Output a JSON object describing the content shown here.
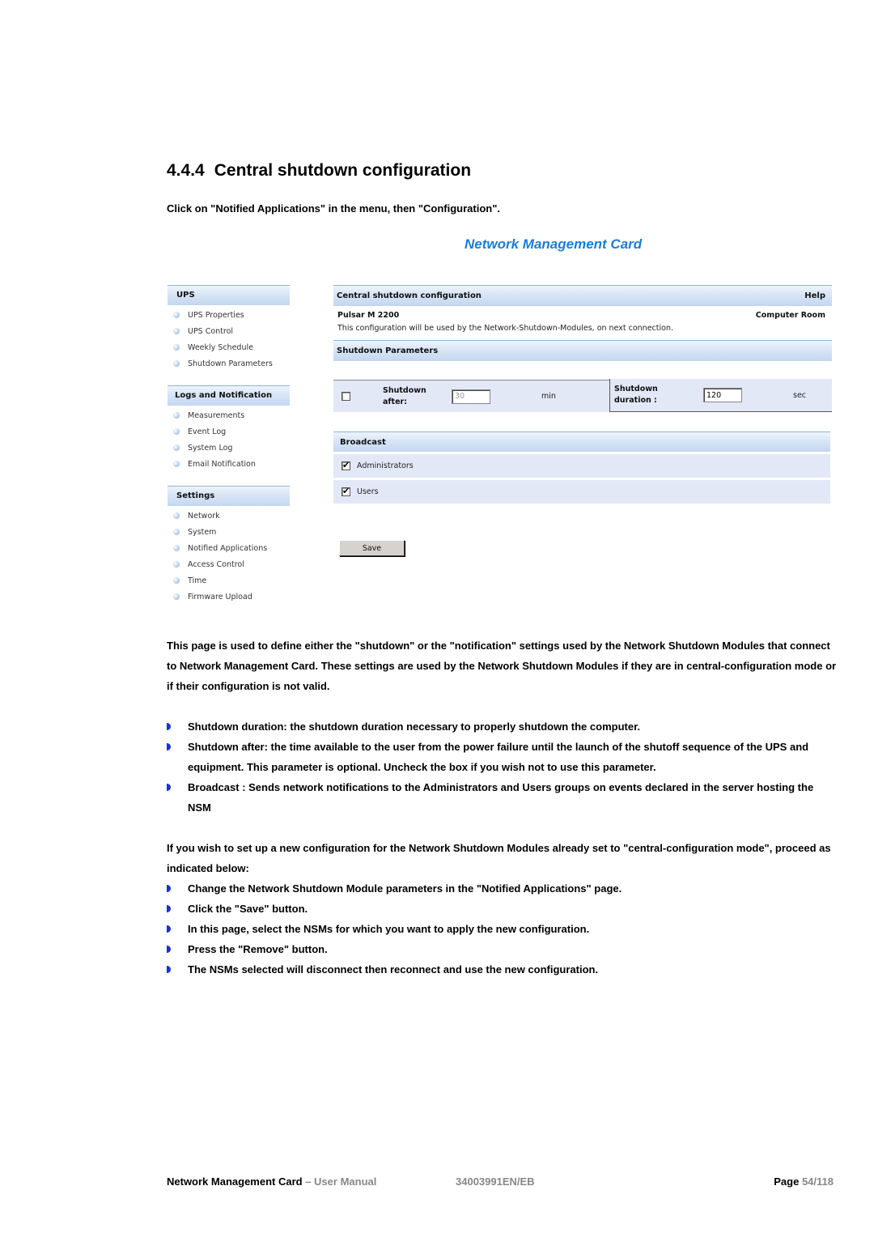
{
  "document": {
    "section_number": "4.4.4",
    "section_title": "Central shutdown configuration",
    "intro": "Click on \"Notified Applications\" in the menu, then \"Configuration\"."
  },
  "screenshot": {
    "app_title": "Network Management Card",
    "sidebar": {
      "groups": [
        {
          "title": "UPS",
          "items": [
            "UPS Properties",
            "UPS Control",
            "Weekly Schedule",
            "Shutdown Parameters"
          ]
        },
        {
          "title": "Logs and Notification",
          "items": [
            "Measurements",
            "Event Log",
            "System Log",
            "Email Notification"
          ]
        },
        {
          "title": "Settings",
          "items": [
            "Network",
            "System",
            "Notified Applications",
            "Access Control",
            "Time",
            "Firmware Upload"
          ]
        }
      ]
    },
    "main": {
      "header_title": "Central shutdown configuration",
      "help_label": "Help",
      "device_name": "Pulsar M 2200",
      "location": "Computer Room",
      "description": "This configuration will be used by the Network-Shutdown-Modules, on next connection.",
      "params_header": "Shutdown Parameters",
      "shutdown_after": {
        "label_line1": "Shutdown",
        "label_line2": "after:",
        "value": "30",
        "unit": "min",
        "checked": false
      },
      "shutdown_duration": {
        "label_line1": "Shutdown",
        "label_line2": "duration :",
        "value": "120",
        "unit": "sec"
      },
      "broadcast_header": "Broadcast",
      "broadcast": [
        {
          "label": "Administrators",
          "checked": true
        },
        {
          "label": "Users",
          "checked": true
        }
      ],
      "save_label": "Save"
    }
  },
  "body": {
    "paragraph1": "This page is used to define either the \"shutdown\" or the \"notification\" settings used by the Network Shutdown Modules that connect to Network Management Card. These settings are used by the Network Shutdown Modules if they are in central-configuration mode or if their configuration is not valid.",
    "bullets1": [
      "Shutdown duration: the shutdown duration necessary to properly shutdown the computer.",
      "Shutdown after: the time available to the user from the power failure until the launch of the shutoff sequence of the UPS and equipment. This parameter is optional. Uncheck the box if you wish not to use this parameter.",
      "Broadcast : Sends network notifications to the Administrators and Users groups on events declared in the server hosting the NSM"
    ],
    "paragraph2": "If you wish to set up a new configuration for the Network Shutdown Modules already set to \"central-configuration mode\", proceed as indicated below:",
    "bullets2": [
      "Change the Network Shutdown Module parameters in the \"Notified Applications\" page.",
      "Click the \"Save\" button.",
      "In this page, select the NSMs for which you want to apply the new configuration.",
      "Press the \"Remove\" button.",
      "The NSMs selected will disconnect then reconnect and use the new configuration."
    ]
  },
  "footer": {
    "product": "Network Management Card",
    "doc_type": " – User Manual",
    "doc_ref": "34003991EN/EB",
    "page_label": "Page ",
    "page_value": "54/118"
  },
  "colors": {
    "accent_blue": "#1a7dd6",
    "bullet_blue": "#1b2fd6",
    "panel_bg": "#e3e8f7"
  }
}
